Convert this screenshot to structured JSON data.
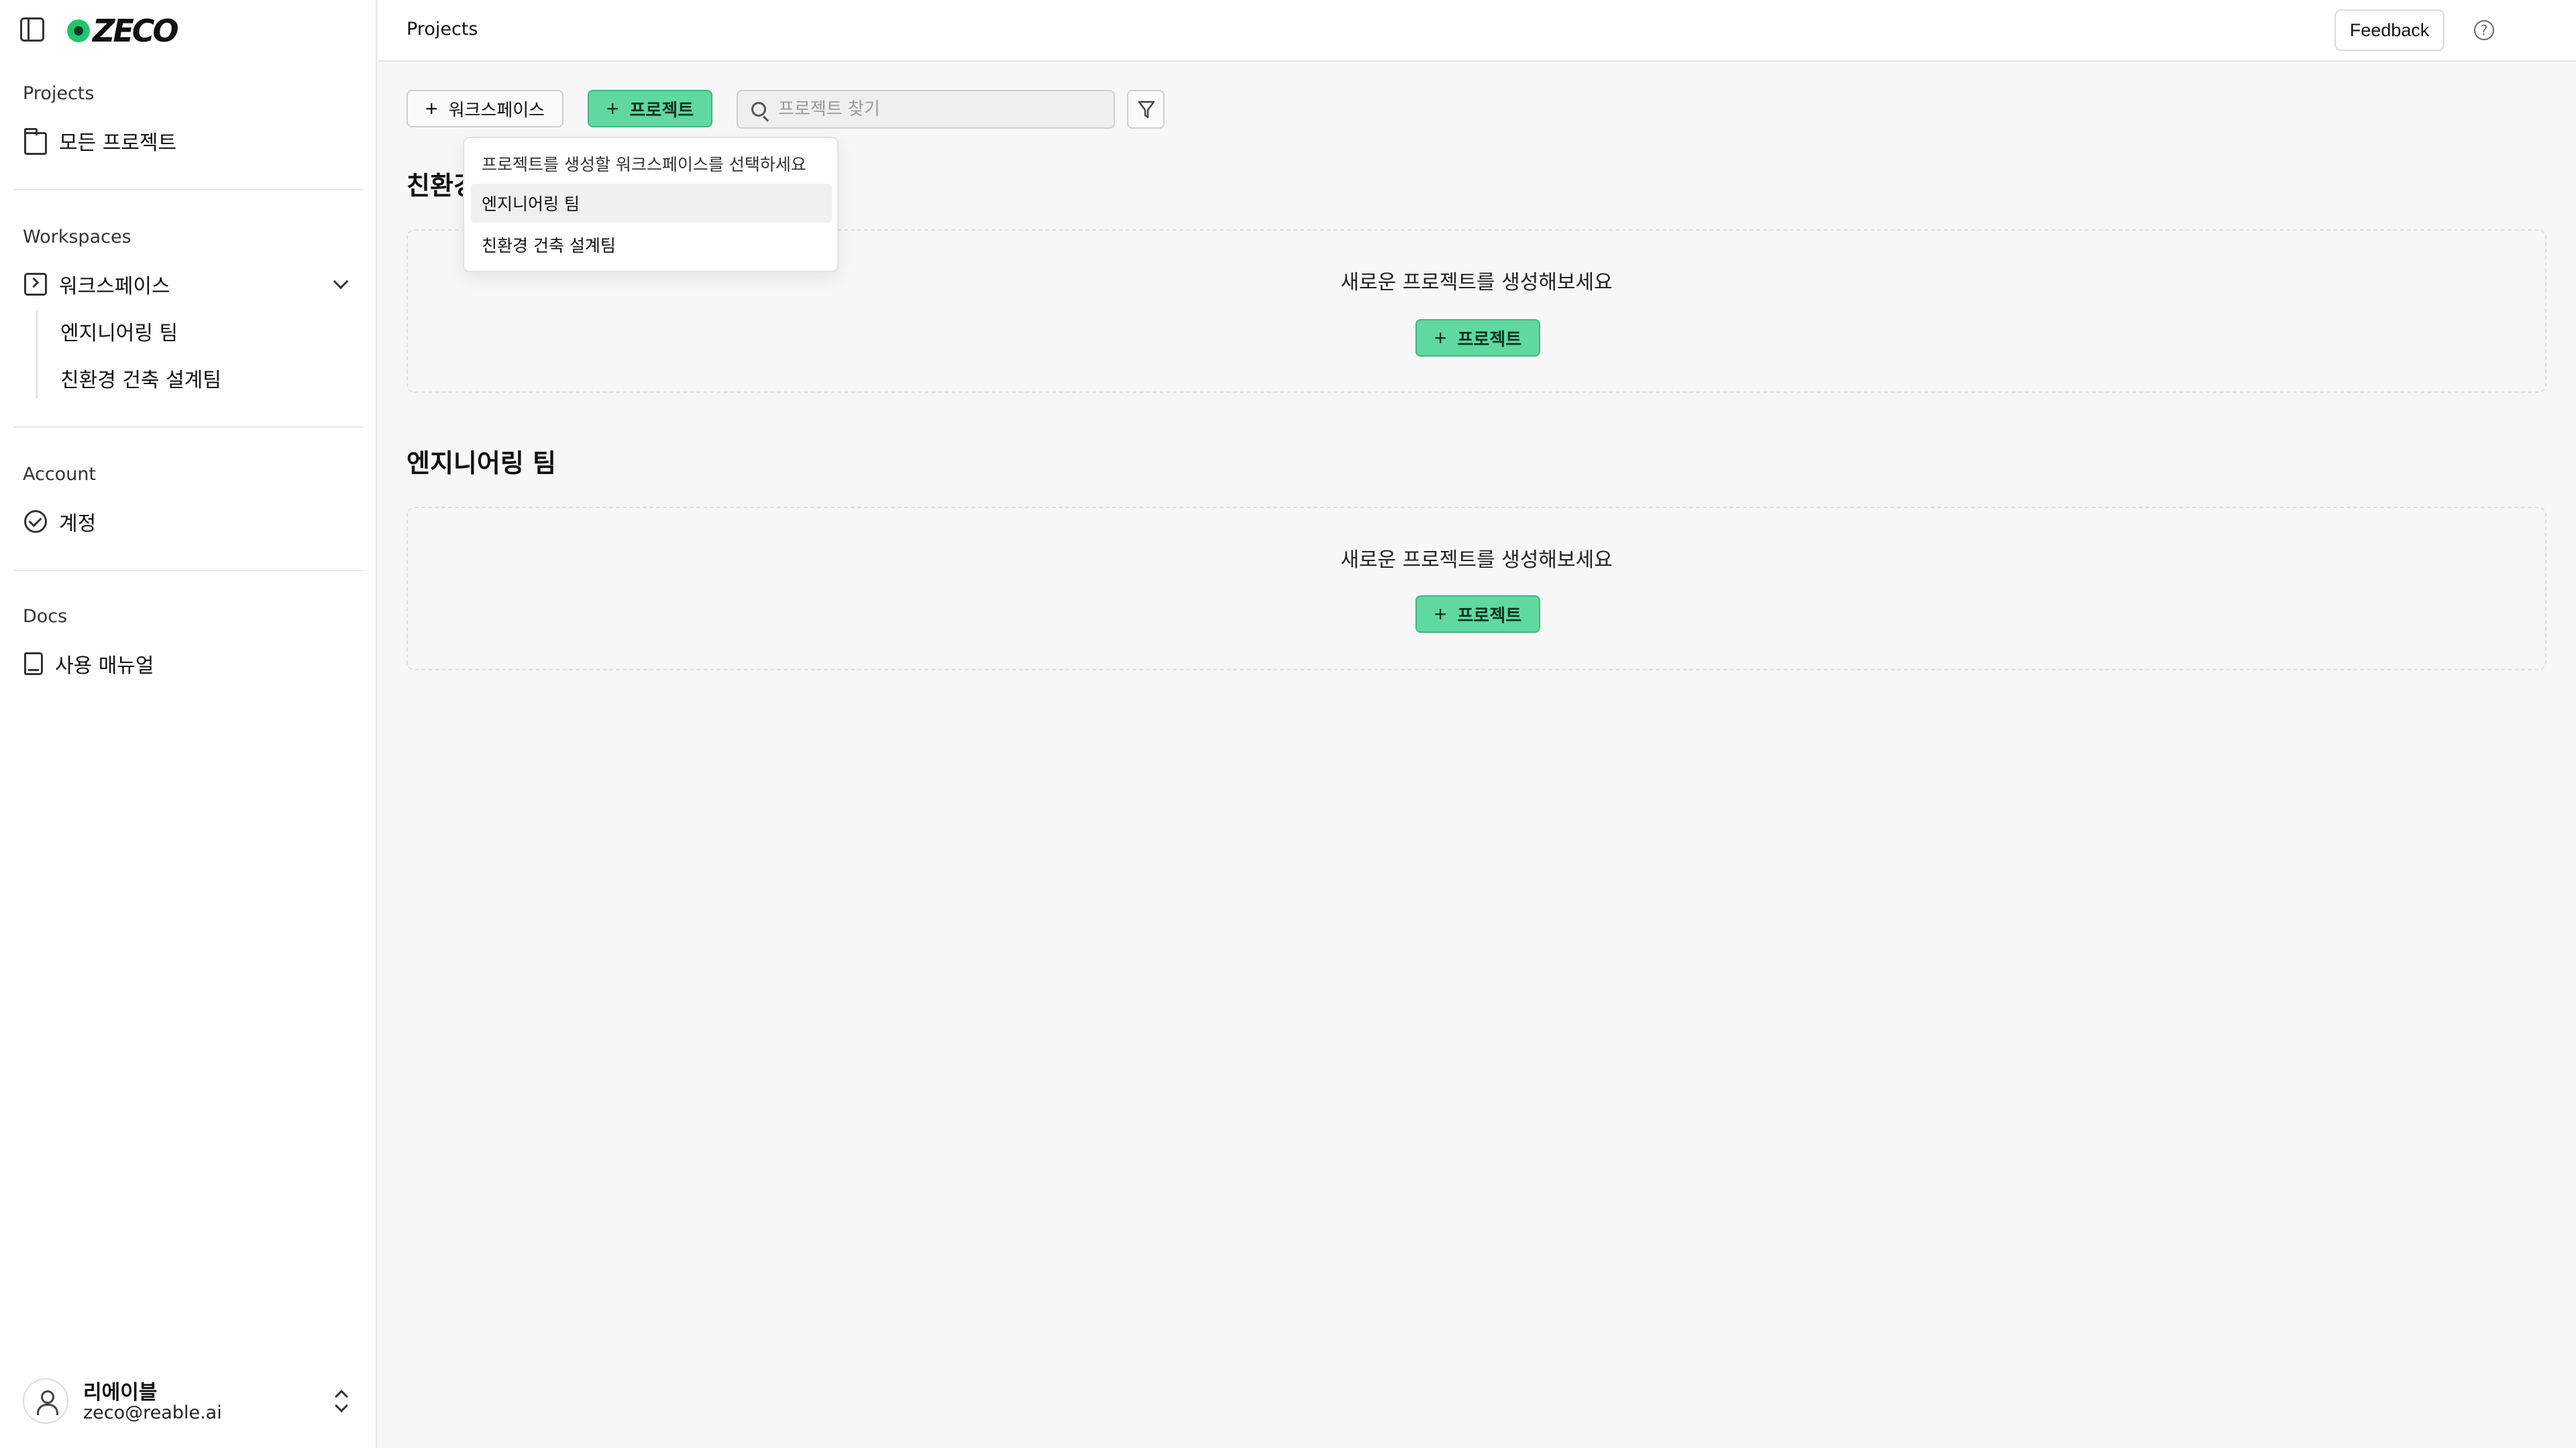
{
  "app": {
    "logo_text": "ZECO"
  },
  "header": {
    "title": "Projects",
    "feedback_label": "Feedback",
    "help_glyph": "?"
  },
  "sidebar": {
    "sections": {
      "projects": "Projects",
      "workspaces": "Workspaces",
      "account": "Account",
      "docs": "Docs"
    },
    "items": {
      "all_projects": "모든 프로젝트",
      "workspace": "워크스페이스",
      "account": "계정",
      "manual": "사용 매뉴얼"
    },
    "workspace_children": [
      "엔지니어링 팀",
      "친환경 건축 설계팀"
    ]
  },
  "user": {
    "name": "리에이블",
    "email": "zeco@reable.ai"
  },
  "toolbar": {
    "workspace_button": "워크스페이스",
    "project_button": "프로젝트",
    "search_placeholder": "프로젝트 찾기",
    "search_value": ""
  },
  "dropdown": {
    "label": "프로젝트를 생성할 워크스페이스를 선택하세요",
    "items": [
      "엔지니어링 팀",
      "친환경 건축 설계팀"
    ],
    "highlighted_index": 0
  },
  "sections": [
    {
      "title": "친환경 건축 설계팀",
      "empty_text": "새로운 프로젝트를 생성해보세요",
      "button": "프로젝트"
    },
    {
      "title": "엔지니어링 팀",
      "empty_text": "새로운 프로젝트를 생성해보세요",
      "button": "프로젝트"
    }
  ],
  "colors": {
    "accent": "#5fd9a0",
    "accent_border": "#3fb680",
    "background": "#f7f7f7",
    "sidebar_bg": "#ffffff"
  },
  "icons": [
    "sidebar-toggle-icon",
    "folder-icon",
    "workspace-icon",
    "chevron-down-icon",
    "check-circle-icon",
    "book-icon",
    "user-icon",
    "chevron-updown-icon",
    "plus-icon",
    "search-icon",
    "filter-icon",
    "help-icon"
  ]
}
